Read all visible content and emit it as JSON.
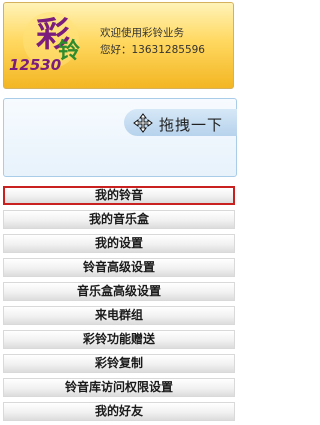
{
  "banner": {
    "logo": {
      "glyph_main": "彩",
      "glyph_secondary": "铃",
      "digits": "12530"
    },
    "welcome_text": "欢迎使用彩铃业务",
    "greeting_text": "您好：13631285596"
  },
  "drag_panel": {
    "label": "拖拽一下"
  },
  "menu": {
    "items": [
      {
        "label": "我的铃音",
        "selected": true
      },
      {
        "label": "我的音乐盒"
      },
      {
        "label": "我的设置"
      },
      {
        "label": "铃音高级设置"
      },
      {
        "label": "音乐盒高级设置"
      },
      {
        "label": "来电群组"
      },
      {
        "label": "彩铃功能赠送"
      },
      {
        "label": "彩铃复制"
      },
      {
        "label": "铃音库访问权限设置"
      },
      {
        "label": "我的好友"
      }
    ]
  },
  "colors": {
    "banner_top": "#fff3b8",
    "banner_bottom": "#f3b623",
    "logo_purple": "#7a1d7d",
    "logo_green": "#2e8b2e",
    "panel_border": "#a9cce8",
    "selected_border": "#c8211f"
  }
}
